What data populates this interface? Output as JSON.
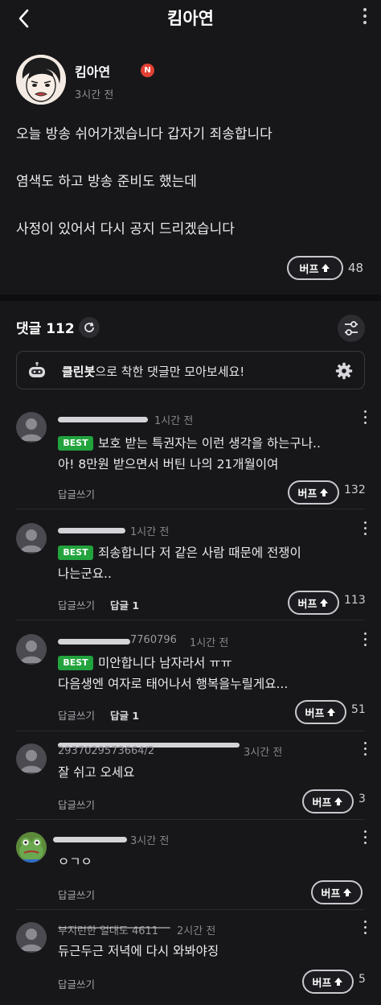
{
  "header": {
    "title": "킴아연",
    "back_icon": "chevron-left-icon",
    "menu_icon": "more-vertical-icon"
  },
  "author": {
    "name": "킴아연",
    "badge": "N",
    "time": "3시간 전"
  },
  "post": {
    "lines": [
      "오늘 방송 쉬어가겠습니다 갑자기 죄송합니다",
      "염색도 하고 방송 준비도 했는데",
      "사정이 있어서 다시 공지 드리겠습니다"
    ],
    "buff_label": "버프",
    "buff_count": "48"
  },
  "comments_header": {
    "label": "댓글",
    "count": "112"
  },
  "cleanbot": {
    "bold": "클린봇",
    "rest": "으로 착한 댓글만 모아보세요!"
  },
  "comment_items": [
    {
      "time": "1시간 전",
      "best": "BEST",
      "lines": [
        "보호 받는 특권자는 이런 생각을 하는구나..",
        "아! 8만원 받으면서 버틴 나의 21개월이여"
      ],
      "reply_label": "답글쓰기",
      "reply_count": "",
      "buff_label": "버프",
      "buff_count": "132"
    },
    {
      "time": "1시간 전",
      "best": "BEST",
      "lines": [
        "죄송합니다 저 같은 사람 때문에 전쟁이",
        "나는군요.."
      ],
      "reply_label": "답글쓰기",
      "reply_count": "답글 1",
      "buff_label": "버프",
      "buff_count": "113"
    },
    {
      "name": "7760796",
      "time": "1시간 전",
      "best": "BEST",
      "lines": [
        "미안합니다 남자라서 ㅠㅠ",
        "다음생엔 여자로 태어나서 행복을누릴게요..."
      ],
      "reply_label": "답글쓰기",
      "reply_count": "답글 1",
      "buff_label": "버프",
      "buff_count": "51"
    },
    {
      "name": "2937029573664/2",
      "time": "3시간 전",
      "best": "",
      "lines": [
        "잘 쉬고 오세요"
      ],
      "reply_label": "답글쓰기",
      "reply_count": "",
      "buff_label": "버프",
      "buff_count": "3"
    },
    {
      "time": "3시간 전",
      "best": "",
      "lines": [
        "ㅇㄱㅇ"
      ],
      "reply_label": "답글쓰기",
      "reply_count": "",
      "buff_label": "버프",
      "buff_count": ""
    },
    {
      "name": "부지런한 얼대도 4611",
      "time": "2시간 전",
      "best": "",
      "lines": [
        "듀근두근 저녁에 다시 와봐야징"
      ],
      "reply_label": "답글쓰기",
      "reply_count": "",
      "buff_label": "버프",
      "buff_count": "5"
    }
  ],
  "colors": {
    "background": "#17171a",
    "best_badge": "#22a33d",
    "n_badge": "#e34034"
  }
}
